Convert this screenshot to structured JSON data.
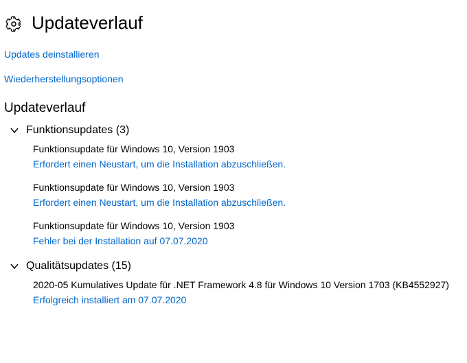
{
  "header": {
    "title": "Updateverlauf"
  },
  "links": {
    "uninstall": "Updates deinstallieren",
    "recovery": "Wiederherstellungsoptionen"
  },
  "section_heading": "Updateverlauf",
  "categories": {
    "feature": {
      "label": "Funktionsupdates (3)",
      "entries": [
        {
          "title": "Funktionsupdate für Windows 10, Version 1903",
          "status": "Erfordert einen Neustart, um die Installation abzuschließen."
        },
        {
          "title": "Funktionsupdate für Windows 10, Version 1903",
          "status": "Erfordert einen Neustart, um die Installation abzuschließen."
        },
        {
          "title": "Funktionsupdate für Windows 10, Version 1903",
          "status": "Fehler bei der Installation auf 07.07.2020"
        }
      ]
    },
    "quality": {
      "label": "Qualitätsupdates (15)",
      "entries": [
        {
          "title": "2020-05 Kumulatives Update für .NET Framework 4.8 für Windows 10 Version 1703 (KB4552927)",
          "status": "Erfolgreich installiert am 07.07.2020"
        }
      ]
    }
  }
}
